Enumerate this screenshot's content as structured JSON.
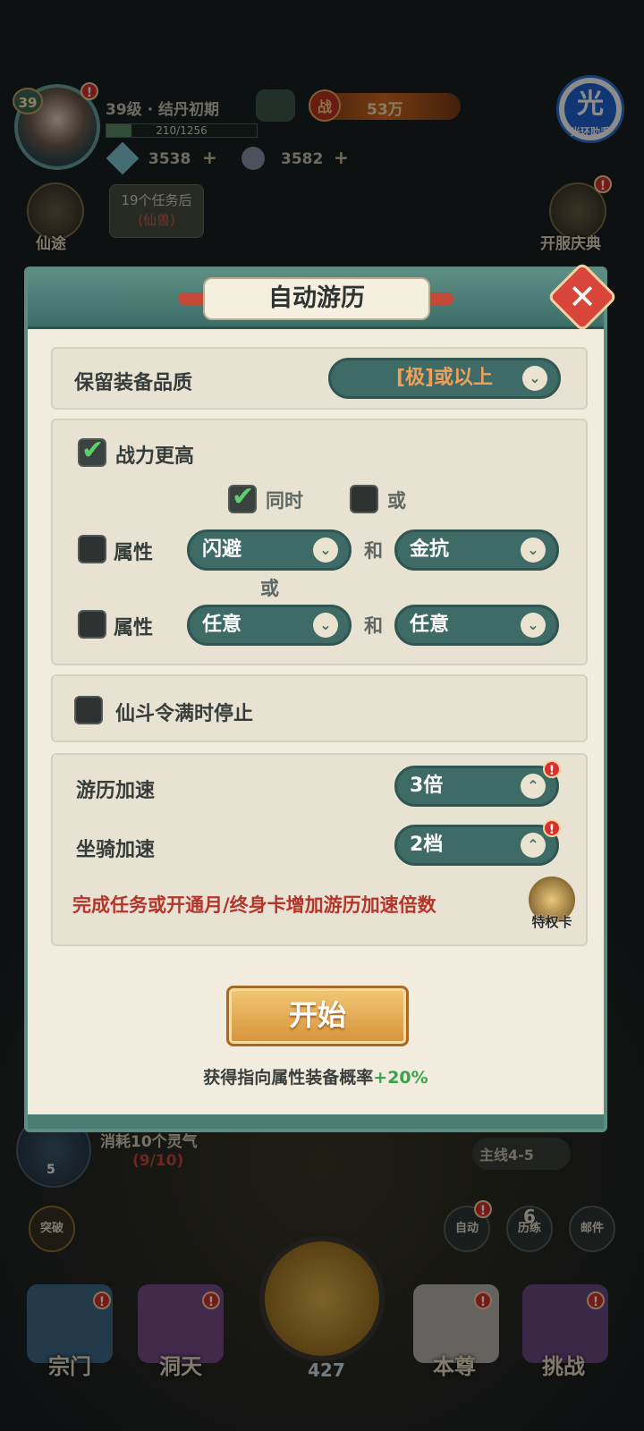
{
  "hud": {
    "level_badge": "39",
    "level_text": "39级 · 结丹初期",
    "exp_text": "210/1256",
    "exp_progress": 0.167,
    "power_tag": "战",
    "power_value": "53万",
    "jade": "3538",
    "coins": "3582",
    "helper_icon": "光",
    "helper_label": "光环助手",
    "xiantu_label": "仙途",
    "task_line1": "19个任务后",
    "task_line2": "(仙兽)",
    "event_label": "开服庆典",
    "notice": "!"
  },
  "dialog": {
    "title": "自动游历",
    "keep_quality_label": "保留装备品质",
    "keep_quality_value": "[极]或以上",
    "higher_power_label": "战力更高",
    "same_time_label": "同时",
    "or_label": "或",
    "attr_label": "属性",
    "attr1_a": "闪避",
    "and_label": "和",
    "attr1_b": "金抗",
    "or_mid": "或",
    "attr2_a": "任意",
    "attr2_b": "任意",
    "stop_label": "仙斗令满时停止",
    "travel_speed_label": "游历加速",
    "travel_speed_value": "3倍",
    "mount_speed_label": "坐骑加速",
    "mount_speed_value": "2档",
    "speed_hint": "完成任务或开通月/终身卡增加游历加速倍数",
    "priv_card_label": "特权卡",
    "start_label": "开始",
    "bonus_text": "获得指向属性装备概率",
    "bonus_value": "+20%"
  },
  "bottom": {
    "consume_text": "消耗10个灵气",
    "consume_count": "(9/10)",
    "spirit_count": "5",
    "mainline": "主线4-5",
    "breakthrough": "突破",
    "auto": "自动",
    "practice_num": "6",
    "practice": "历练",
    "mail": "邮件",
    "sword_count": "427",
    "nav": [
      "宗门",
      "洞天",
      "本尊",
      "挑战"
    ]
  },
  "colors": {
    "teal": "#3e6b66",
    "panel_bg": "#f1ecde",
    "check_green": "#5dd06a",
    "hint_red": "#b3352c",
    "bonus_green": "#3aa34a"
  }
}
